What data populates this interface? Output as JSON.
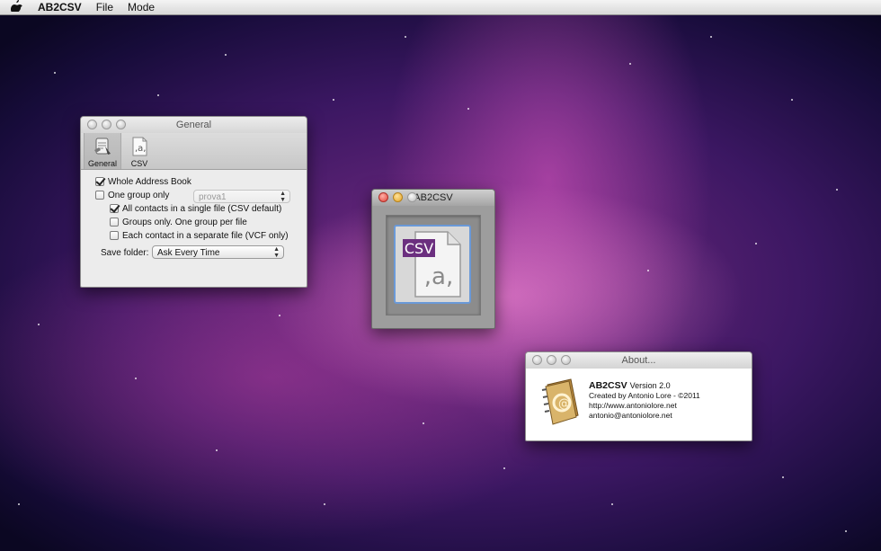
{
  "menubar": {
    "app_name": "AB2CSV",
    "items": [
      "File",
      "Mode"
    ]
  },
  "general_window": {
    "title": "General",
    "toolbar": [
      {
        "label": "General",
        "icon": "general-icon"
      },
      {
        "label": "CSV",
        "icon": "csv-doc-icon"
      }
    ],
    "options": {
      "whole_book": {
        "label": "Whole Address Book",
        "checked": true
      },
      "one_group": {
        "label": "One group only",
        "checked": false
      },
      "group_popup": "prova1",
      "all_contacts": {
        "label": "All contacts in a single file (CSV default)",
        "checked": true
      },
      "groups_only": {
        "label": "Groups only. One group per file",
        "checked": false
      },
      "each_contact": {
        "label": "Each contact in a separate file (VCF only)",
        "checked": false
      }
    },
    "save_folder": {
      "label": "Save folder:",
      "value": "Ask Every Time"
    }
  },
  "main_window": {
    "title": "AB2CSV",
    "badge": "CSV",
    "doc_text": ",a,"
  },
  "about_window": {
    "title": "About...",
    "app_name": "AB2CSV",
    "version": "Version 2.0",
    "created_by": "Created by Antonio Lore - ©2011",
    "website": "http://www.antoniolore.net",
    "email": "antonio@antoniolore.net"
  }
}
